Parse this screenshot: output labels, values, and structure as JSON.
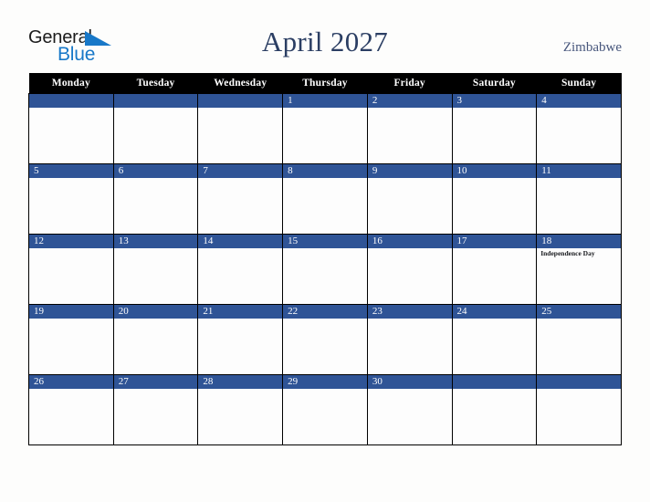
{
  "brand": {
    "line1": "General",
    "line2": "Blue",
    "mark": "triangle-flag-icon"
  },
  "header": {
    "title": "April 2027",
    "country": "Zimbabwe"
  },
  "colors": {
    "page_background": "#fdfdfc",
    "header_bar": "#000000",
    "day_bar": "#2f5496",
    "title_text": "#2b3e63",
    "country_text": "#47567c",
    "brand_blue": "#1878c8",
    "grid_line": "#000000"
  },
  "calendar": {
    "month": "April",
    "year": "2027",
    "week_start": "Monday",
    "weekday_headers": [
      "Monday",
      "Tuesday",
      "Wednesday",
      "Thursday",
      "Friday",
      "Saturday",
      "Sunday"
    ],
    "weeks": [
      [
        {
          "day": "",
          "events": []
        },
        {
          "day": "",
          "events": []
        },
        {
          "day": "",
          "events": []
        },
        {
          "day": "1",
          "events": []
        },
        {
          "day": "2",
          "events": []
        },
        {
          "day": "3",
          "events": []
        },
        {
          "day": "4",
          "events": []
        }
      ],
      [
        {
          "day": "5",
          "events": []
        },
        {
          "day": "6",
          "events": []
        },
        {
          "day": "7",
          "events": []
        },
        {
          "day": "8",
          "events": []
        },
        {
          "day": "9",
          "events": []
        },
        {
          "day": "10",
          "events": []
        },
        {
          "day": "11",
          "events": []
        }
      ],
      [
        {
          "day": "12",
          "events": []
        },
        {
          "day": "13",
          "events": []
        },
        {
          "day": "14",
          "events": []
        },
        {
          "day": "15",
          "events": []
        },
        {
          "day": "16",
          "events": []
        },
        {
          "day": "17",
          "events": []
        },
        {
          "day": "18",
          "events": [
            "Independence Day"
          ]
        }
      ],
      [
        {
          "day": "19",
          "events": []
        },
        {
          "day": "20",
          "events": []
        },
        {
          "day": "21",
          "events": []
        },
        {
          "day": "22",
          "events": []
        },
        {
          "day": "23",
          "events": []
        },
        {
          "day": "24",
          "events": []
        },
        {
          "day": "25",
          "events": []
        }
      ],
      [
        {
          "day": "26",
          "events": []
        },
        {
          "day": "27",
          "events": []
        },
        {
          "day": "28",
          "events": []
        },
        {
          "day": "29",
          "events": []
        },
        {
          "day": "30",
          "events": []
        },
        {
          "day": "",
          "events": []
        },
        {
          "day": "",
          "events": []
        }
      ]
    ]
  }
}
